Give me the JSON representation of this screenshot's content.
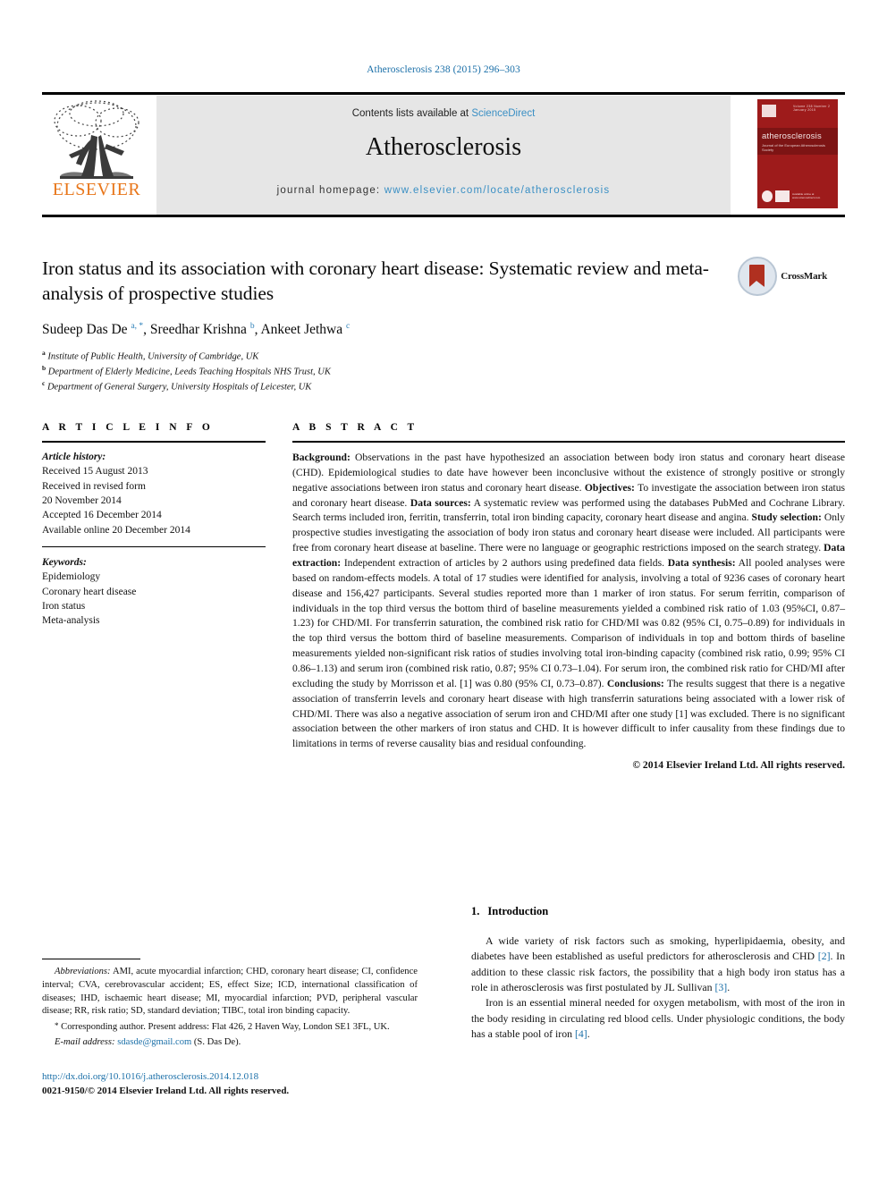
{
  "running_head": "Atherosclerosis 238 (2015) 296–303",
  "masthead": {
    "publisher_name": "ELSEVIER",
    "contents_prefix": "Contents lists available at ",
    "contents_link": "ScienceDirect",
    "journal_name": "Atherosclerosis",
    "homepage_prefix": "journal homepage: ",
    "homepage_url": "www.elsevier.com/locate/atherosclerosis",
    "cover": {
      "title": "atherosclerosis",
      "subtitle": "Journal of the European Atherosclerosis Society",
      "top_text": "Volume 238  Number 2  January 2015",
      "badge_text": "Available online at\nwww.sciencedirect.com"
    }
  },
  "article": {
    "title": "Iron status and its association with coronary heart disease: Systematic review and meta-analysis of prospective studies",
    "authors_html": "Sudeep Das De <sup>a, *</sup>, Sreedhar Krishna <sup>b</sup>, Ankeet Jethwa <sup>c</sup>",
    "crossmark_label": "CrossMark",
    "affiliations": [
      {
        "mark": "a",
        "text": "Institute of Public Health, University of Cambridge, UK"
      },
      {
        "mark": "b",
        "text": "Department of Elderly Medicine, Leeds Teaching Hospitals NHS Trust, UK"
      },
      {
        "mark": "c",
        "text": "Department of General Surgery, University Hospitals of Leicester, UK"
      }
    ]
  },
  "article_info": {
    "heading": "A R T I C L E  I N F O",
    "history_label": "Article history:",
    "history": [
      "Received 15 August 2013",
      "Received in revised form",
      "20 November 2014",
      "Accepted 16 December 2014",
      "Available online 20 December 2014"
    ],
    "keywords_label": "Keywords:",
    "keywords": [
      "Epidemiology",
      "Coronary heart disease",
      "Iron status",
      "Meta-analysis"
    ]
  },
  "abstract": {
    "heading": "A B S T R A C T",
    "html": "<b>Background:</b> Observations in the past have hypothesized an association between body iron status and coronary heart disease (CHD). Epidemiological studies to date have however been inconclusive without the existence of strongly positive or strongly negative associations between iron status and coronary heart disease. <b>Objectives:</b> To investigate the association between iron status and coronary heart disease. <b>Data sources:</b> A systematic review was performed using the databases PubMed and Cochrane Library. Search terms included iron, ferritin, transferrin, total iron binding capacity, coronary heart disease and angina. <b>Study selection:</b> Only prospective studies investigating the association of body iron status and coronary heart disease were included. All participants were free from coronary heart disease at baseline. There were no language or geographic restrictions imposed on the search strategy. <b>Data extraction:</b> Independent extraction of articles by 2 authors using predefined data fields. <b>Data synthesis:</b> All pooled analyses were based on random-effects models. A total of 17 studies were identified for analysis, involving a total of 9236 cases of coronary heart disease and 156,427 participants. Several studies reported more than 1 marker of iron status. For serum ferritin, comparison of individuals in the top third versus the bottom third of baseline measurements yielded a combined risk ratio of 1.03 (95%CI, 0.87–1.23) for CHD/MI. For transferrin saturation, the combined risk ratio for CHD/MI was 0.82 (95% CI, 0.75–0.89) for individuals in the top third versus the bottom third of baseline measurements. Comparison of individuals in top and bottom thirds of baseline measurements yielded non-significant risk ratios of studies involving total iron-binding capacity (combined risk ratio, 0.99; 95% CI 0.86–1.13) and serum iron (combined risk ratio, 0.87; 95% CI 0.73–1.04). For serum iron, the combined risk ratio for CHD/MI after excluding the study by Morrisson et al. [1] was 0.80 (95% CI, 0.73–0.87). <b>Conclusions:</b> The results suggest that there is a negative association of transferrin levels and coronary heart disease with high transferrin saturations being associated with a lower risk of CHD/MI. There was also a negative association of serum iron and CHD/MI after one study [1] was excluded. There is no significant association between the other markers of iron status and CHD. It is however difficult to infer causality from these findings due to limitations in terms of reverse causality bias and residual confounding.",
    "copyright": "© 2014 Elsevier Ireland Ltd. All rights reserved."
  },
  "introduction": {
    "number": "1.",
    "heading": "Introduction",
    "paragraphs_html": [
      "A wide variety of risk factors such as smoking, hyperlipidaemia, obesity, and diabetes have been established as useful predictors for atherosclerosis and CHD <span class=\"ref\">[2]</span>. In addition to these classic risk factors, the possibility that a high body iron status has a role in atherosclerosis was first postulated by JL Sullivan <span class=\"ref\">[3]</span>.",
      "Iron is an essential mineral needed for oxygen metabolism, with most of the iron in the body residing in circulating red blood cells. Under physiologic conditions, the body has a stable pool of iron <span class=\"ref\">[4]</span>."
    ]
  },
  "footnotes": {
    "abbreviations_label": "Abbreviations:",
    "abbreviations_text": "AMI, acute myocardial infarction; CHD, coronary heart disease; CI, confidence interval; CVA, cerebrovascular accident; ES, effect Size; ICD, international classification of diseases; IHD, ischaemic heart disease; MI, myocardial infarction; PVD, peripheral vascular disease; RR, risk ratio; SD, standard deviation; TIBC, total iron binding capacity.",
    "corresponding_mark": "*",
    "corresponding_text": "Corresponding author. Present address: Flat 426, 2 Haven Way, London SE1 3FL, UK.",
    "email_label": "E-mail address:",
    "email": "sdasde@gmail.com",
    "email_suffix": "(S. Das De).",
    "doi": "http://dx.doi.org/10.1016/j.atherosclerosis.2014.12.018",
    "issn_line": "0021-9150/© 2014 Elsevier Ireland Ltd. All rights reserved."
  }
}
